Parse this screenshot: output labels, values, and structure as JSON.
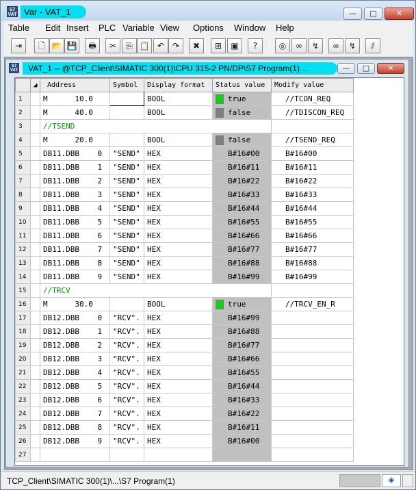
{
  "window": {
    "title": "Var - VAT_1",
    "icon": "vat-app-icon",
    "buttons": {
      "minimize": "—",
      "maximize": "□",
      "close": "✕"
    }
  },
  "menu": [
    "Table",
    "Edit",
    "Insert",
    "PLC",
    "Variable",
    "View",
    "Options",
    "Window",
    "Help"
  ],
  "toolbar": [
    {
      "name": "insert-row-icon",
      "glyph": "⇥"
    },
    {
      "name": "new-icon",
      "glyph": "🗋"
    },
    {
      "name": "open-icon",
      "glyph": "📂"
    },
    {
      "name": "save-icon",
      "glyph": "💾"
    },
    {
      "name": "print-icon",
      "glyph": "🖶"
    },
    {
      "name": "cut-icon",
      "glyph": "✂"
    },
    {
      "name": "copy-icon",
      "glyph": "⎘"
    },
    {
      "name": "paste-icon",
      "glyph": "📋"
    },
    {
      "name": "undo-icon",
      "glyph": "↶"
    },
    {
      "name": "redo-icon",
      "glyph": "↷"
    },
    {
      "name": "delete-icon",
      "glyph": "✖"
    },
    {
      "name": "online-icon",
      "glyph": "⊞"
    },
    {
      "name": "cpu-icon",
      "glyph": "▣"
    },
    {
      "name": "help-icon",
      "glyph": "?"
    },
    {
      "name": "monitor-icon",
      "glyph": "◎"
    },
    {
      "name": "monitor-var-icon",
      "glyph": "∞"
    },
    {
      "name": "modify-var-icon",
      "glyph": "↯"
    },
    {
      "name": "monitor-trigger-icon",
      "glyph": "∞"
    },
    {
      "name": "modify-trigger-icon",
      "glyph": "↯"
    },
    {
      "name": "activate-icon",
      "glyph": "⫽"
    }
  ],
  "child": {
    "title": "VAT_1 -- @TCP_Client\\SIMATIC 300(1)\\CPU 315-2 PN/DP\\S7 Program(1)  ..."
  },
  "columns": [
    "Address",
    "Symbol",
    "Display format",
    "Status value",
    "Modify value"
  ],
  "rows": [
    {
      "n": "1",
      "addr": "M      10.0",
      "sym": "",
      "fmt": "BOOL",
      "ind": "on",
      "status": "true",
      "mod": "//TCON_REQ"
    },
    {
      "n": "2",
      "addr": "M      40.0",
      "sym": "",
      "fmt": "BOOL",
      "ind": "off",
      "status": "false",
      "mod": "//TDISCON_REQ"
    },
    {
      "n": "3",
      "comment": "//TSEND"
    },
    {
      "n": "4",
      "addr": "M      20.0",
      "sym": "",
      "fmt": "BOOL",
      "ind": "off",
      "status": "false",
      "mod": "//TSEND_REQ"
    },
    {
      "n": "5",
      "addr": "DB11.DBB    0",
      "sym": "\"SEND\"",
      "fmt": "HEX",
      "status": "B#16#00",
      "mod": "B#16#00"
    },
    {
      "n": "6",
      "addr": "DB11.DBB    1",
      "sym": "\"SEND\"",
      "fmt": "HEX",
      "status": "B#16#11",
      "mod": "B#16#11"
    },
    {
      "n": "7",
      "addr": "DB11.DBB    2",
      "sym": "\"SEND\"",
      "fmt": "HEX",
      "status": "B#16#22",
      "mod": "B#16#22"
    },
    {
      "n": "8",
      "addr": "DB11.DBB    3",
      "sym": "\"SEND\"",
      "fmt": "HEX",
      "status": "B#16#33",
      "mod": "B#16#33"
    },
    {
      "n": "9",
      "addr": "DB11.DBB    4",
      "sym": "\"SEND\"",
      "fmt": "HEX",
      "status": "B#16#44",
      "mod": "B#16#44"
    },
    {
      "n": "10",
      "addr": "DB11.DBB    5",
      "sym": "\"SEND\"",
      "fmt": "HEX",
      "status": "B#16#55",
      "mod": "B#16#55"
    },
    {
      "n": "11",
      "addr": "DB11.DBB    6",
      "sym": "\"SEND\"",
      "fmt": "HEX",
      "status": "B#16#66",
      "mod": "B#16#66"
    },
    {
      "n": "12",
      "addr": "DB11.DBB    7",
      "sym": "\"SEND\"",
      "fmt": "HEX",
      "status": "B#16#77",
      "mod": "B#16#77"
    },
    {
      "n": "13",
      "addr": "DB11.DBB    8",
      "sym": "\"SEND\"",
      "fmt": "HEX",
      "status": "B#16#88",
      "mod": "B#16#88"
    },
    {
      "n": "14",
      "addr": "DB11.DBB    9",
      "sym": "\"SEND\"",
      "fmt": "HEX",
      "status": "B#16#99",
      "mod": "B#16#99"
    },
    {
      "n": "15",
      "comment": "//TRCV"
    },
    {
      "n": "16",
      "addr": "M      30.0",
      "sym": "",
      "fmt": "BOOL",
      "ind": "on",
      "status": "true",
      "mod": "//TRCV_EN_R"
    },
    {
      "n": "17",
      "addr": "DB12.DBB    0",
      "sym": "\"RCV\".",
      "fmt": "HEX",
      "status": "B#16#99",
      "mod": ""
    },
    {
      "n": "18",
      "addr": "DB12.DBB    1",
      "sym": "\"RCV\".",
      "fmt": "HEX",
      "status": "B#16#88",
      "mod": ""
    },
    {
      "n": "19",
      "addr": "DB12.DBB    2",
      "sym": "\"RCV\".",
      "fmt": "HEX",
      "status": "B#16#77",
      "mod": ""
    },
    {
      "n": "20",
      "addr": "DB12.DBB    3",
      "sym": "\"RCV\".",
      "fmt": "HEX",
      "status": "B#16#66",
      "mod": ""
    },
    {
      "n": "21",
      "addr": "DB12.DBB    4",
      "sym": "\"RCV\".",
      "fmt": "HEX",
      "status": "B#16#55",
      "mod": ""
    },
    {
      "n": "22",
      "addr": "DB12.DBB    5",
      "sym": "\"RCV\".",
      "fmt": "HEX",
      "status": "B#16#44",
      "mod": ""
    },
    {
      "n": "23",
      "addr": "DB12.DBB    6",
      "sym": "\"RCV\".",
      "fmt": "HEX",
      "status": "B#16#33",
      "mod": ""
    },
    {
      "n": "24",
      "addr": "DB12.DBB    7",
      "sym": "\"RCV\".",
      "fmt": "HEX",
      "status": "B#16#22",
      "mod": ""
    },
    {
      "n": "25",
      "addr": "DB12.DBB    8",
      "sym": "\"RCV\".",
      "fmt": "HEX",
      "status": "B#16#11",
      "mod": ""
    },
    {
      "n": "26",
      "addr": "DB12.DBB    9",
      "sym": "\"RCV\".",
      "fmt": "HEX",
      "status": "B#16#00",
      "mod": ""
    },
    {
      "n": "27",
      "addr": "",
      "sym": "",
      "fmt": "",
      "status": "",
      "mod": ""
    }
  ],
  "statusbar": {
    "path": "TCP_Client\\SIMATIC 300(1)\\...\\S7 Program(1)"
  },
  "colors": {
    "title_highlight": "#00e0f0",
    "status_on": "#16d116",
    "status_off": "#808080",
    "status_cell": "#c0c0c0",
    "comment": "#0a9a0a"
  }
}
